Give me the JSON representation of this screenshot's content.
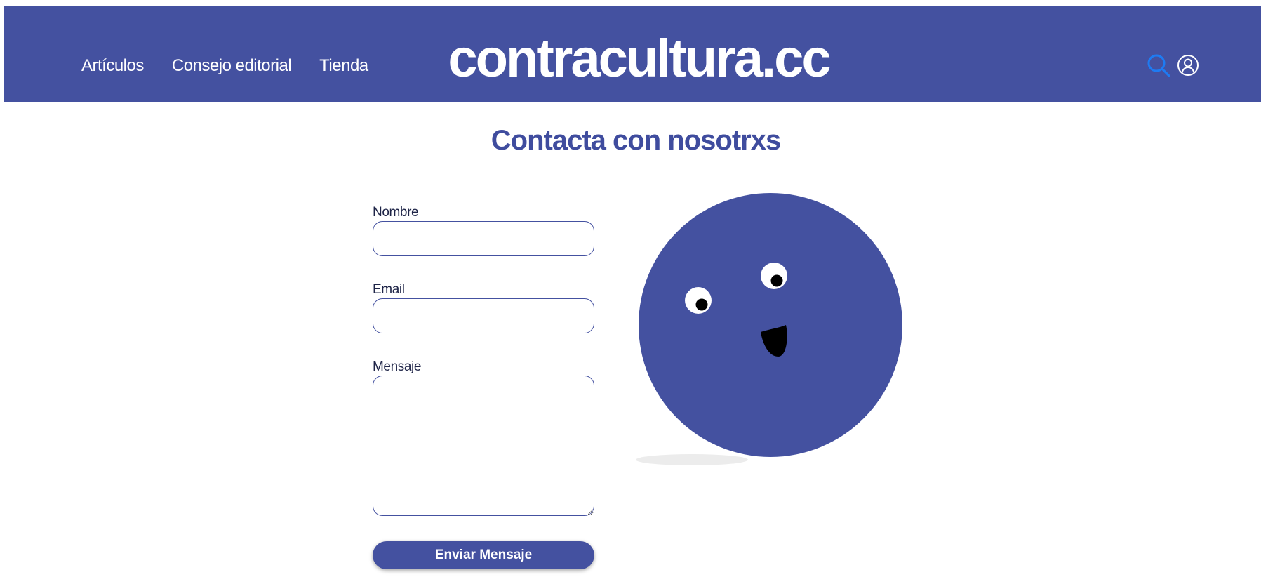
{
  "header": {
    "nav": [
      {
        "label": "Artículos"
      },
      {
        "label": "Consejo editorial"
      },
      {
        "label": "Tienda"
      }
    ],
    "site_title": "contracultura.cc",
    "icons": {
      "search": "search-icon",
      "user": "user-icon"
    }
  },
  "main": {
    "title": "Contacta con nosotrxs",
    "form": {
      "name_label": "Nombre",
      "name_value": "",
      "email_label": "Email",
      "email_value": "",
      "message_label": "Mensaje",
      "message_value": "",
      "submit_label": "Enviar Mensaje"
    },
    "illustration": "smiling-blob-face"
  },
  "colors": {
    "brand": "#4451a0",
    "search_icon": "#1e7bf2",
    "text_dark": "#1e2447"
  }
}
